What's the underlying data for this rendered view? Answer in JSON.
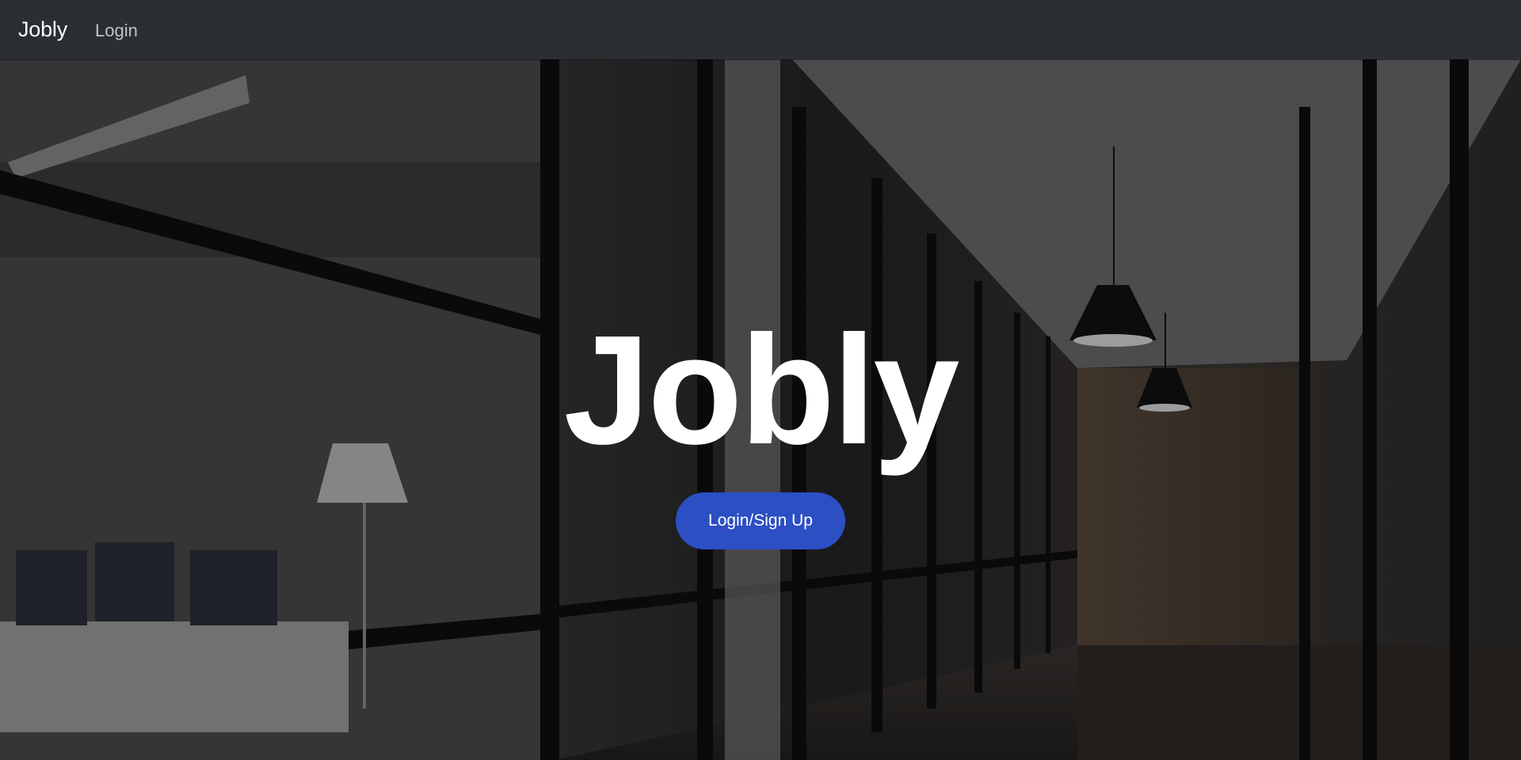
{
  "navbar": {
    "brand": "Jobly",
    "links": [
      {
        "label": "Login"
      }
    ]
  },
  "hero": {
    "title": "Jobly",
    "cta_label": "Login/Sign Up",
    "background_image": "office-glass-corridor"
  },
  "colors": {
    "navbar_bg": "#2b2f33",
    "cta_bg": "#2c4fc4",
    "text": "#ffffff"
  }
}
